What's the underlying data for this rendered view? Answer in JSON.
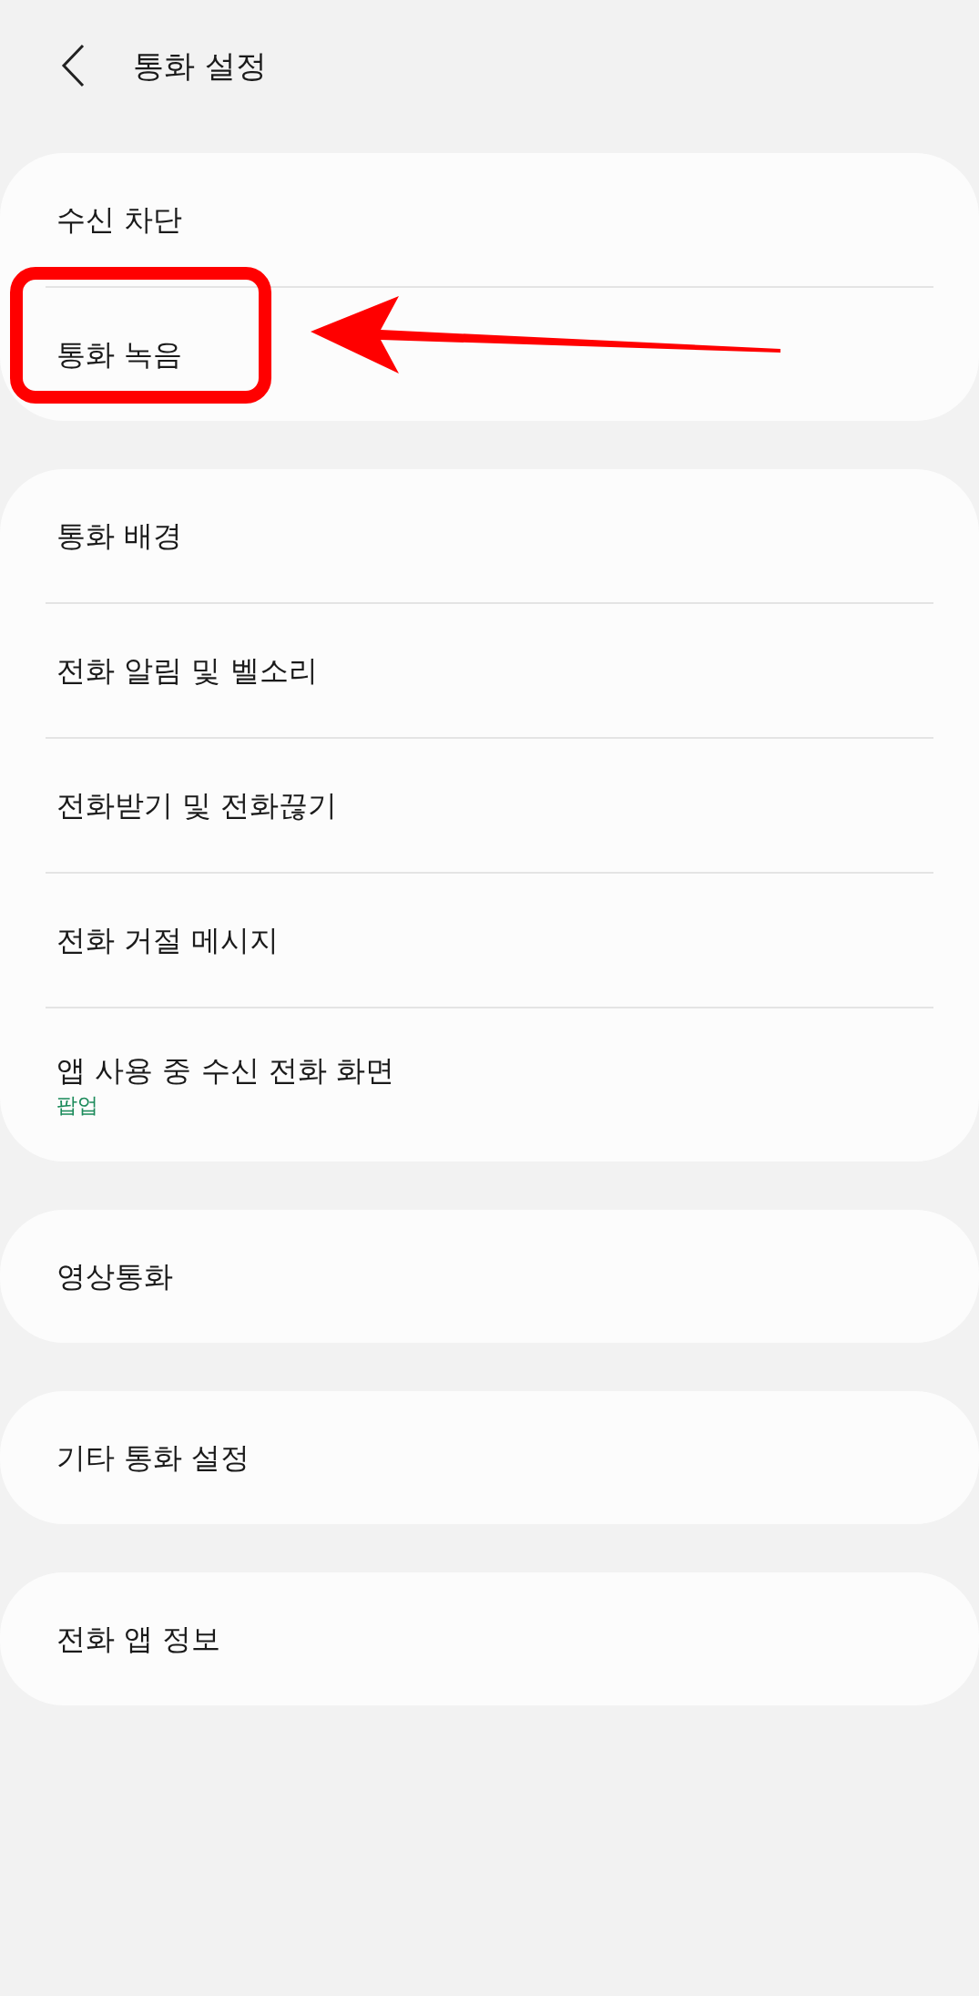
{
  "header": {
    "title": "통화 설정"
  },
  "groups": [
    {
      "items": [
        {
          "label": "수신 차단",
          "highlighted": false
        },
        {
          "label": "통화 녹음",
          "highlighted": true
        }
      ]
    },
    {
      "items": [
        {
          "label": "통화 배경",
          "highlighted": false
        },
        {
          "label": "전화 알림 및 벨소리",
          "highlighted": false
        },
        {
          "label": "전화받기 및 전화끊기",
          "highlighted": false
        },
        {
          "label": "전화 거절 메시지",
          "highlighted": false
        },
        {
          "label": "앱 사용 중 수신 전화 화면",
          "subtitle": "팝업",
          "highlighted": false
        }
      ]
    },
    {
      "items": [
        {
          "label": "영상통화",
          "highlighted": false
        }
      ]
    },
    {
      "items": [
        {
          "label": "기타 통화 설정",
          "highlighted": false
        }
      ]
    },
    {
      "items": [
        {
          "label": "전화 앱 정보",
          "highlighted": false
        }
      ]
    }
  ]
}
